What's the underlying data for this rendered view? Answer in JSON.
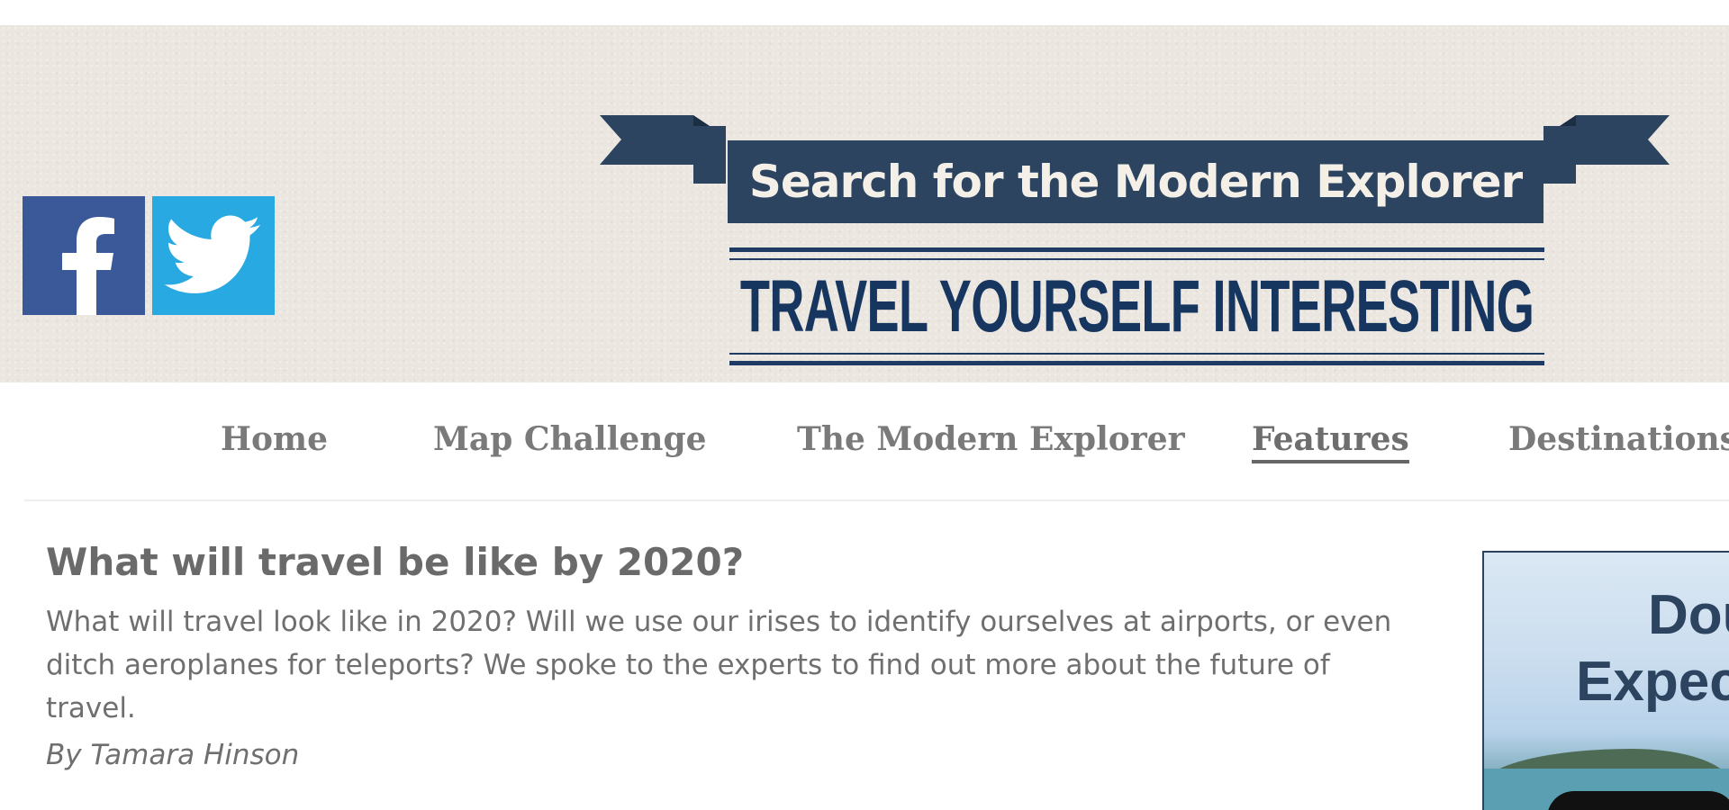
{
  "header": {
    "logo_title": "Search for the Modern Explorer",
    "tagline": "TRAVEL YOURSELF INTERESTING",
    "colors": {
      "banner": "#2d4460",
      "tagline": "#163660",
      "background": "#ebe6df"
    }
  },
  "social": {
    "facebook_icon": "facebook-icon",
    "twitter_icon": "twitter-icon"
  },
  "nav": {
    "items": [
      {
        "label": "Home"
      },
      {
        "label": "Map Challenge"
      },
      {
        "label": "The Modern Explorer"
      },
      {
        "label": "Features",
        "active": true
      },
      {
        "label": "Destinations"
      }
    ]
  },
  "article": {
    "title": "What will travel be like by 2020?",
    "summary": "What will travel look like in 2020? Will we use our irises to identify ourselves at airports, or even ditch aeroplanes for teleports? We spoke to the experts to find out more about the future of travel.",
    "author": "By Tamara Hinson"
  },
  "ad": {
    "line1": "Dou",
    "line2": "Expec"
  }
}
